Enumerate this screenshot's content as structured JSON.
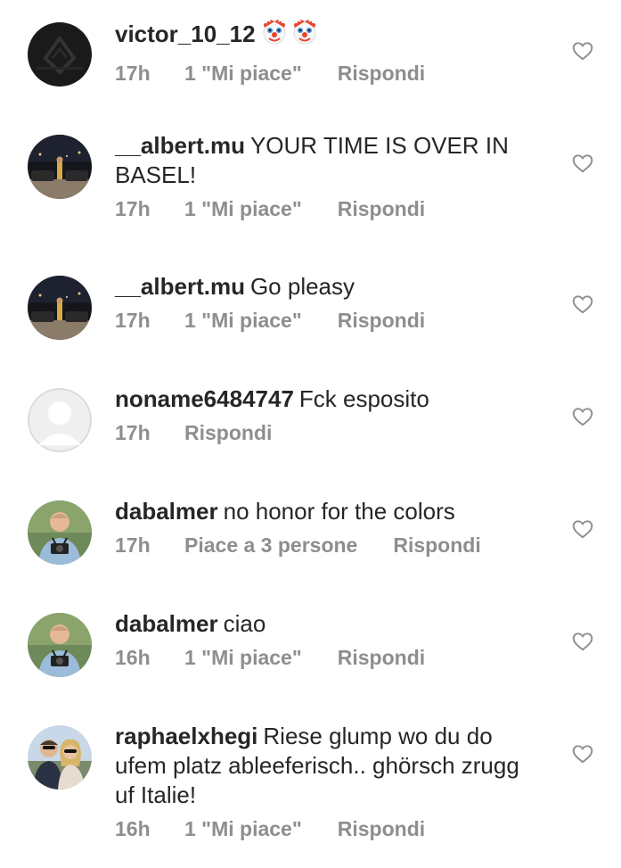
{
  "comments": [
    {
      "username": "victor_10_12",
      "text": "",
      "emoji": "clown-face-icon",
      "time": "17h",
      "likes": "1 \"Mi piace\"",
      "reply": "Rispondi",
      "avatar": "dark-logo-avatar"
    },
    {
      "username": "__albert.mu",
      "text": "YOUR TIME IS OVER IN BASEL!",
      "time": "17h",
      "likes": "1 \"Mi piace\"",
      "reply": "Rispondi",
      "avatar": "night-car-avatar"
    },
    {
      "username": "__albert.mu",
      "text": "Go pleasy",
      "time": "17h",
      "likes": "1 \"Mi piace\"",
      "reply": "Rispondi",
      "avatar": "night-car-avatar"
    },
    {
      "username": "noname6484747",
      "text": "Fck esposito",
      "time": "17h",
      "likes": "",
      "reply": "Rispondi",
      "avatar": "default-avatar"
    },
    {
      "username": "dabalmer",
      "text": "no honor for the colors",
      "time": "17h",
      "likes": "Piace a 3 persone",
      "reply": "Rispondi",
      "avatar": "photographer-avatar"
    },
    {
      "username": "dabalmer",
      "text": "ciao",
      "time": "16h",
      "likes": "1 \"Mi piace\"",
      "reply": "Rispondi",
      "avatar": "photographer-avatar"
    },
    {
      "username": "raphaelxhegi",
      "text": "Riese glump wo du do ufem platz ableeferisch.. ghörsch zrugg uf Italie!",
      "time": "16h",
      "likes": "1 \"Mi piace\"",
      "reply": "Rispondi",
      "avatar": "couple-avatar"
    }
  ],
  "colors": {
    "text": "#262626",
    "meta": "#8e8e8e",
    "heart_outline": "#8e8e8e"
  },
  "icons": {
    "like": "heart-outline-icon"
  }
}
